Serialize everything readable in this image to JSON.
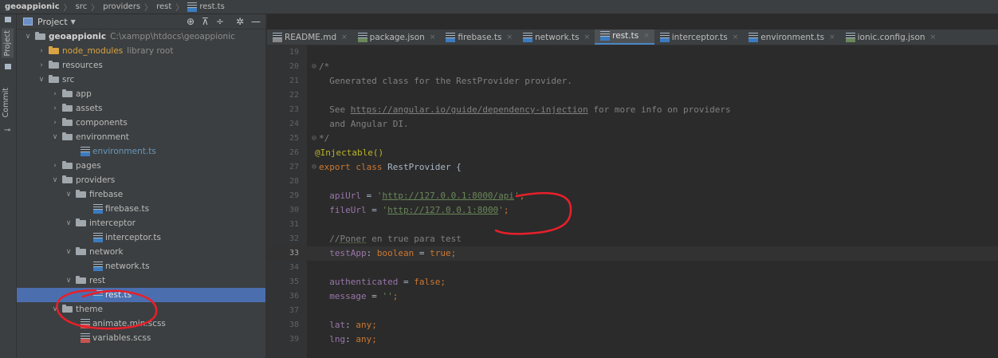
{
  "breadcrumb": {
    "items": [
      "geoappionic",
      "src",
      "providers",
      "rest",
      "rest.ts"
    ]
  },
  "left_strip": {
    "project_label": "Project",
    "commit_label": "Commit"
  },
  "project_panel": {
    "title": "Project",
    "tool_icons": [
      "target-icon",
      "collapse-all-icon",
      "expand-all-icon",
      "gear-icon",
      "minimize-icon"
    ],
    "tool_glyphs": [
      "⊕",
      "⊼",
      "÷",
      "✲",
      "—"
    ]
  },
  "tree": {
    "root": {
      "name": "geoappionic",
      "path": "C:\\xampp\\htdocs\\geoappionic"
    },
    "node_modules": {
      "name": "node_modules",
      "note": "library root"
    },
    "items": {
      "resources": "resources",
      "src": "src",
      "app": "app",
      "assets": "assets",
      "components": "components",
      "environment": "environment",
      "environment_ts": "environment.ts",
      "pages": "pages",
      "providers": "providers",
      "firebase": "firebase",
      "firebase_ts": "firebase.ts",
      "interceptor": "interceptor",
      "interceptor_ts": "interceptor.ts",
      "network": "network",
      "network_ts": "network.ts",
      "rest": "rest",
      "rest_ts": "rest.ts",
      "theme": "theme",
      "animate_scss": "animate.min.scss",
      "variables_scss": "variables.scss"
    }
  },
  "tabs": [
    {
      "label": "README.md"
    },
    {
      "label": "package.json"
    },
    {
      "label": "firebase.ts"
    },
    {
      "label": "network.ts"
    },
    {
      "label": "rest.ts"
    },
    {
      "label": "interceptor.ts"
    },
    {
      "label": "environment.ts"
    },
    {
      "label": "ionic.config.json"
    }
  ],
  "close_glyph": "×",
  "editor": {
    "current_line": 33,
    "line_numbers": [
      "19",
      "20",
      "21",
      "22",
      "23",
      "24",
      "25",
      "26",
      "27",
      "28",
      "29",
      "30",
      "31",
      "32",
      "33",
      "34",
      "35",
      "36",
      "37",
      "38",
      "39"
    ],
    "code": {
      "l20": "/*",
      "l21": "  Generated class for the RestProvider provider.",
      "l23a": "  See ",
      "l23b": "https://angular.io/guide/dependency-injection",
      "l23c": " for more info on providers",
      "l24": "  and Angular DI.",
      "l25": "*/",
      "l26": "@Injectable()",
      "l27a": "export class ",
      "l27b": "RestProvider {",
      "l29a": "  apiUrl",
      "l29b": " = ",
      "l29c": "'",
      "l29d": "http://127.0.0.1:8000/api",
      "l29e": "'",
      "l29f": ";",
      "l30a": "  fileUrl",
      "l30b": " = ",
      "l30c": "'",
      "l30d": "http://127.0.0.1:8000",
      "l30e": "'",
      "l30f": ";",
      "l32a": "  //",
      "l32b": "Poner",
      "l32c": " en true para test",
      "l33a": "  testApp",
      "l33b": ": ",
      "l33c": "boolean",
      "l33d": " = ",
      "l33e": "true",
      "l33f": ";",
      "l35a": "  authenticated",
      "l35b": " = ",
      "l35c": "false",
      "l35d": ";",
      "l36a": "  message",
      "l36b": " = ",
      "l36c": "''",
      "l36d": ";",
      "l38a": "  lat",
      "l38b": ": ",
      "l38c": "any",
      "l38d": ";",
      "l39a": "  lng",
      "l39b": ": ",
      "l39c": "any",
      "l39d": ";"
    }
  },
  "colors": {
    "annotation_red": "#e8202a",
    "selection_blue": "#4b6eaf",
    "active_tab_underline": "#4a88c7"
  }
}
